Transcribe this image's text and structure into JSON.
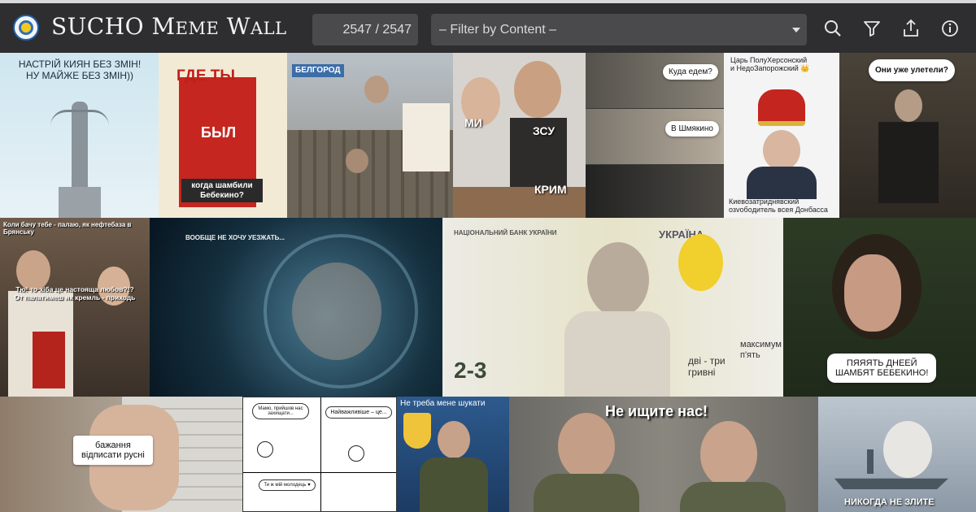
{
  "header": {
    "title_big1": "SUCHO M",
    "title_small1": "EME",
    "title_big2": " W",
    "title_small2": "ALL",
    "counter": "2547 / 2547",
    "filter_placeholder": "– Filter by Content –",
    "icons": [
      "search-icon",
      "filter-icon",
      "share-icon",
      "info-icon"
    ]
  },
  "memes": {
    "m1": {
      "text": "НАСТРІЙ КИЯН БЕЗ ЗМІН!\nНУ МАЙЖЕ БЕЗ ЗМІН))"
    },
    "m2": {
      "top": "ГДЕ ТЫ",
      "mid": "БЫЛ",
      "bottom": "когда шамбили\nБебекино?"
    },
    "m3": {
      "sign": "БЕЛГОРОД"
    },
    "m4": {
      "left": "МИ",
      "right": "ЗСУ",
      "bottom": "КРИМ"
    },
    "m5": {
      "q": "Куда едем?",
      "a": "В Шмякино"
    },
    "m6": {
      "top": "Царь ПолуХерсонский\nи НедоЗапорожский 👑",
      "bottom": "Киевозатриднявский\nозvобoдитель всея Донбасса"
    },
    "m7": {
      "bubble": "Они уже улетели?"
    },
    "m8": {
      "top": "Коли бачу тебе - палаю, як нефтебаза в Брянську",
      "bottom": "Тю! то хіба це настояща любов?!?\nОт палатимеш як кремль - приходь"
    },
    "m9": {
      "text": "ВООБЩЕ НЕ ХОЧУ УЕЗЖАТЬ..."
    },
    "m10": {
      "bank": "НАЦІОНАЛЬНИЙ БАНК УКРАЇНИ",
      "country": "УКРАЇНА",
      "value": "2-3",
      "words": "дві - три\nгривні",
      "side": "максимум\nп'ять"
    },
    "m11": {
      "bubble": "ПЯЯЯТЬ ДНЕЕЙ\nШАМБЯТ БЕБЕКИНО!"
    },
    "m12": {
      "bubble": "бажання\nвідписати русні"
    },
    "m13": {
      "b1": "Мамо, прийшов нас захищати...",
      "b2": "Найважливіше – це...",
      "b3": "Ти ж мій молодець ♥"
    },
    "m14": {
      "text": "Не треба мене шукати"
    },
    "m15": {
      "text": "Не ищите нас!"
    },
    "m16": {
      "text": "НИКОГДА НЕ ЗЛИТЕ"
    }
  },
  "colors": {
    "topbar": "#2e2e30",
    "field": "#4a4a4d",
    "accent_blue": "#1f5fa8",
    "accent_yellow": "#f3c91f"
  }
}
